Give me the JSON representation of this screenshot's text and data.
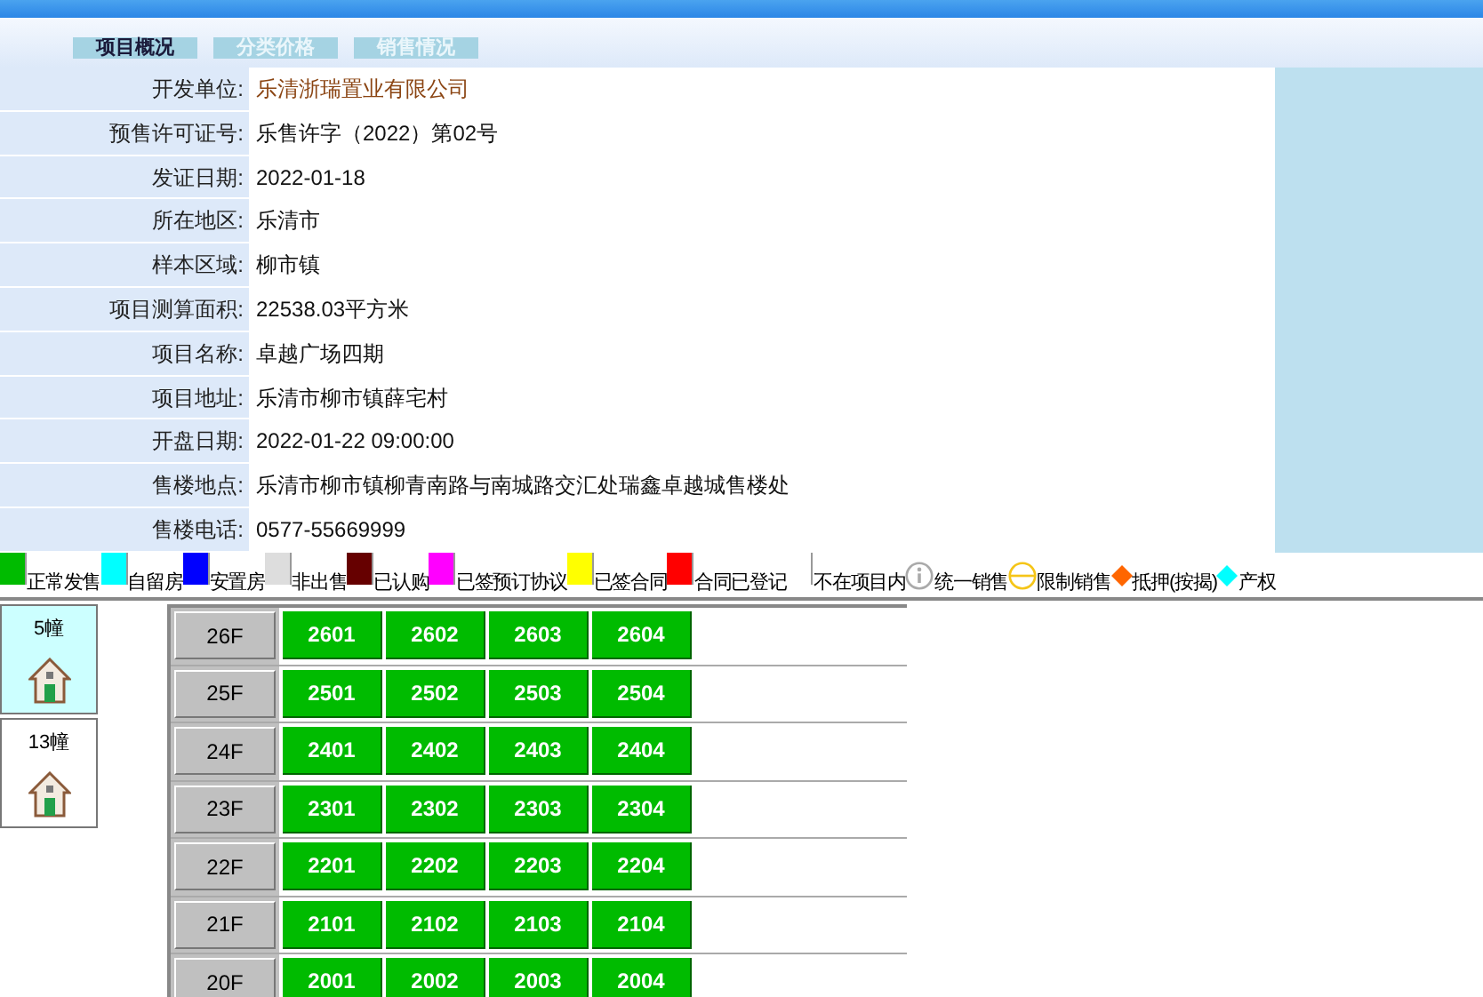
{
  "tabs": [
    {
      "label": "项目概况",
      "selected": true
    },
    {
      "label": "分类价格",
      "selected": false
    },
    {
      "label": "销售情况",
      "selected": false
    }
  ],
  "info": [
    {
      "label": "开发单位:",
      "value": "乐清浙瑞置业有限公司",
      "kind": "link"
    },
    {
      "label": "预售许可证号:",
      "value": "乐售许字（2022）第02号",
      "kind": "text"
    },
    {
      "label": "发证日期:",
      "value": "2022-01-18",
      "kind": "text"
    },
    {
      "label": "所在地区:",
      "value": "乐清市",
      "kind": "text"
    },
    {
      "label": "样本区域:",
      "value": "柳市镇",
      "kind": "text"
    },
    {
      "label": "项目测算面积:",
      "value": "22538.03平方米",
      "kind": "text"
    },
    {
      "label": "项目名称:",
      "value": "卓越广场四期",
      "kind": "text"
    },
    {
      "label": "项目地址:",
      "value": "乐清市柳市镇薛宅村",
      "kind": "text"
    },
    {
      "label": "开盘日期:",
      "value": "2022-01-22 09:00:00",
      "kind": "text"
    },
    {
      "label": "售楼地点:",
      "value": "乐清市柳市镇柳青南路与南城路交汇处瑞鑫卓越城售楼处",
      "kind": "text"
    },
    {
      "label": "售楼电话:",
      "value": "0577-55669999",
      "kind": "text"
    }
  ],
  "legend": [
    {
      "kind": "swatch",
      "color": "#00bb00",
      "label": "正常发售"
    },
    {
      "kind": "swatch",
      "color": "#00ffff",
      "label": "自留房"
    },
    {
      "kind": "swatch",
      "color": "#0000ff",
      "label": "安置房"
    },
    {
      "kind": "swatch",
      "color": "#dddddd",
      "label": "非出售"
    },
    {
      "kind": "swatch",
      "color": "#660000",
      "label": "已认购"
    },
    {
      "kind": "swatch",
      "color": "#ff00ff",
      "label": "已签预订协议"
    },
    {
      "kind": "swatch",
      "color": "#ffff00",
      "label": "已签合同"
    },
    {
      "kind": "swatch",
      "color": "#ff0000",
      "label": "合同已登记"
    },
    {
      "kind": "swatch",
      "color": "#ffffff",
      "label": "不在项目内"
    },
    {
      "kind": "info",
      "label": "统一销售"
    },
    {
      "kind": "circle",
      "label": "限制销售"
    },
    {
      "kind": "diamond",
      "color": "#ff6600",
      "label": "抵押(按揭)"
    },
    {
      "kind": "diamond",
      "color": "#00ffff",
      "label": "产权"
    }
  ],
  "buildings": [
    {
      "label": "5幢",
      "selected": true
    },
    {
      "label": "13幢",
      "selected": false
    }
  ],
  "floors": [
    {
      "label": "26F",
      "units": [
        "2601",
        "2602",
        "2603",
        "2604"
      ]
    },
    {
      "label": "25F",
      "units": [
        "2501",
        "2502",
        "2503",
        "2504"
      ]
    },
    {
      "label": "24F",
      "units": [
        "2401",
        "2402",
        "2403",
        "2404"
      ]
    },
    {
      "label": "23F",
      "units": [
        "2301",
        "2302",
        "2303",
        "2304"
      ]
    },
    {
      "label": "22F",
      "units": [
        "2201",
        "2202",
        "2203",
        "2204"
      ]
    },
    {
      "label": "21F",
      "units": [
        "2101",
        "2102",
        "2103",
        "2104"
      ]
    },
    {
      "label": "20F",
      "units": [
        "2001",
        "2002",
        "2003",
        "2004"
      ]
    }
  ]
}
